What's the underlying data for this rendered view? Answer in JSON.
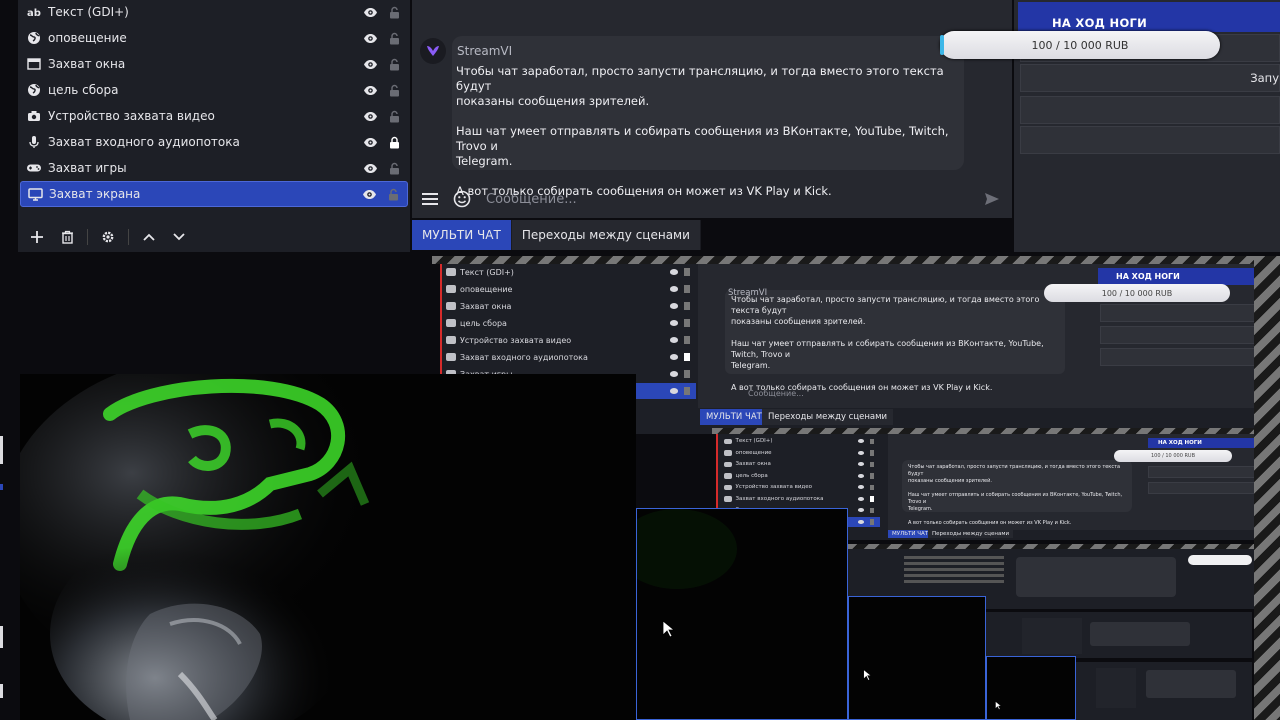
{
  "sources": {
    "items": [
      {
        "label": "Текст (GDI+)",
        "icon": "text-icon",
        "locked": false,
        "active": false
      },
      {
        "label": "оповещение",
        "icon": "globe-icon",
        "locked": false,
        "active": false
      },
      {
        "label": "Захват окна",
        "icon": "window-icon",
        "locked": false,
        "active": false
      },
      {
        "label": "цель сбора",
        "icon": "globe-icon",
        "locked": false,
        "active": false
      },
      {
        "label": "Устройство захвата видео",
        "icon": "camera-icon",
        "locked": false,
        "active": false
      },
      {
        "label": "Захват входного аудиопотока",
        "icon": "microphone-icon",
        "locked": true,
        "active": false
      },
      {
        "label": "Захват игры",
        "icon": "gamepad-icon",
        "locked": false,
        "active": false
      },
      {
        "label": "Захват экрана",
        "icon": "monitor-icon",
        "locked": false,
        "active": true
      }
    ],
    "toolbar": [
      "add-icon",
      "trash-icon",
      "gear-icon",
      "chevron-up-icon",
      "chevron-down-icon"
    ]
  },
  "chat": {
    "sender": "StreamVI",
    "message": "Чтобы чат заработал, просто запусти трансляцию, и тогда вместо этого текста будут\nпоказаны сообщения зрителей.\n\nНаш чат умеет отправлять и собирать сообщения из ВКонтакте, YouTube, Twitch, Trovo и\nTelegram.\n\nА вот только собирать сообщения он может из VK Play и Kick.",
    "input_placeholder": "Сообщение...",
    "tabs": [
      {
        "label": "МУЛЬТИ ЧАТ",
        "active": true
      },
      {
        "label": "Переходы между сценами",
        "active": false
      }
    ]
  },
  "goal": {
    "title": "НА ХОД НОГИ",
    "progress_text": "100 / 10 000 RUB",
    "progress_fraction": 0.01,
    "side_text": "Запу"
  },
  "colors": {
    "accent": "#2b47b8",
    "goal_blue": "#2336a6",
    "panel": "#1d1f26",
    "chat_bg": "#26282f",
    "webcam_green": "#3fe02a"
  }
}
